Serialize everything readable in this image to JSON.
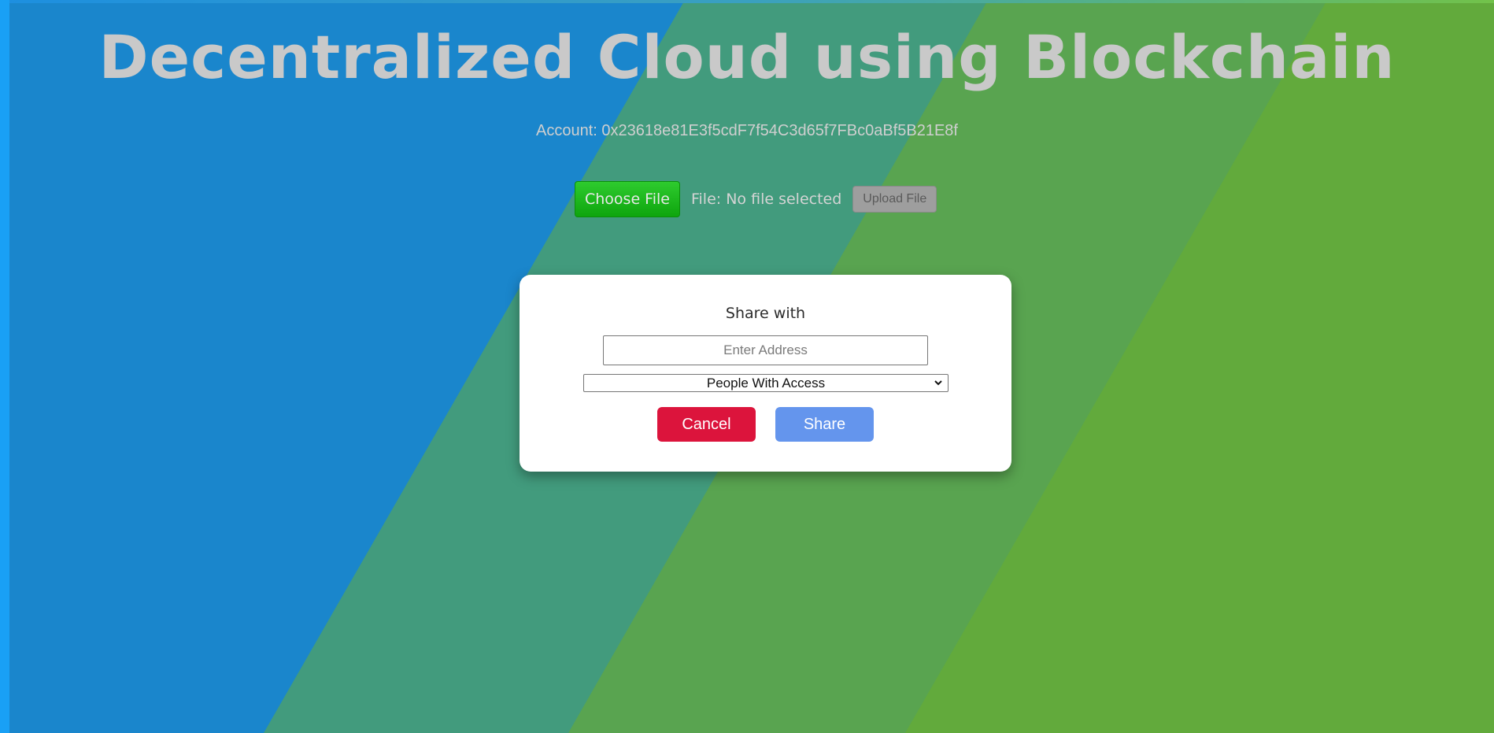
{
  "header": {
    "title": "Decentralized Cloud using Blockchain",
    "account_label": "Account:",
    "account_address": "0x23618e81E3f5cdF7f54C3d65f7FBc0aBf5B21E8f"
  },
  "upload": {
    "choose_file_label": "Choose File",
    "file_status": "File: No file selected",
    "upload_button_label": "Upload File"
  },
  "share_modal": {
    "title": "Share with",
    "address_placeholder": "Enter Address",
    "address_value": "",
    "access_select_value": "People With Access",
    "cancel_label": "Cancel",
    "share_label": "Share"
  },
  "colors": {
    "bg_blue": "#1a86cc",
    "bg_teal": "#429b7d",
    "bg_green_mid": "#59a450",
    "bg_green": "#62aa3c",
    "title_text": "#c9c9c9",
    "choose_file": "#14b014",
    "upload_button": "#9e9e9e",
    "cancel": "#dc143c",
    "share": "#6495ed"
  },
  "icons": {
    "select_arrow": "chevron-down-icon"
  }
}
